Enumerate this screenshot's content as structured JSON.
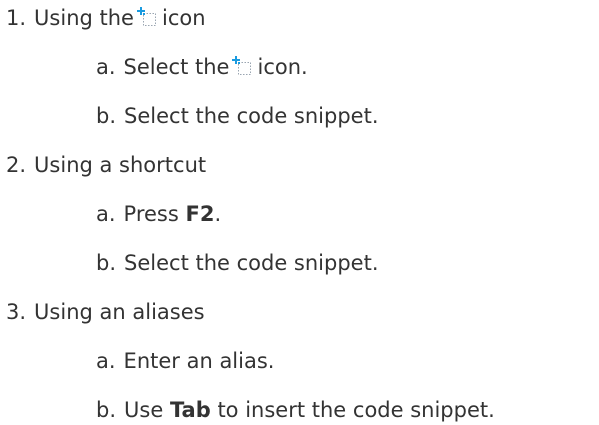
{
  "steps": [
    {
      "marker": "1.",
      "text_before": "Using the",
      "icon": "insert-snippet-icon",
      "text_after": "icon",
      "substeps": [
        {
          "marker": "a.",
          "text_before": "Select the",
          "icon": "insert-snippet-icon",
          "text_after": "icon."
        },
        {
          "marker": "b.",
          "text": "Select the code snippet."
        }
      ]
    },
    {
      "marker": "2.",
      "text": "Using a shortcut",
      "substeps": [
        {
          "marker": "a.",
          "text_before": "Press",
          "bold": "F2",
          "text_after": "."
        },
        {
          "marker": "b.",
          "text": "Select the code snippet."
        }
      ]
    },
    {
      "marker": "3.",
      "text": "Using an aliases",
      "substeps": [
        {
          "marker": "a.",
          "text": "Enter an alias."
        },
        {
          "marker": "b.",
          "text_before": "Use",
          "bold": "Tab",
          "text_after": "to insert the code snippet."
        }
      ]
    }
  ],
  "colors": {
    "text": "#333333",
    "icon_accent": "#1a9be0",
    "icon_frame": "#9aa5b1"
  }
}
